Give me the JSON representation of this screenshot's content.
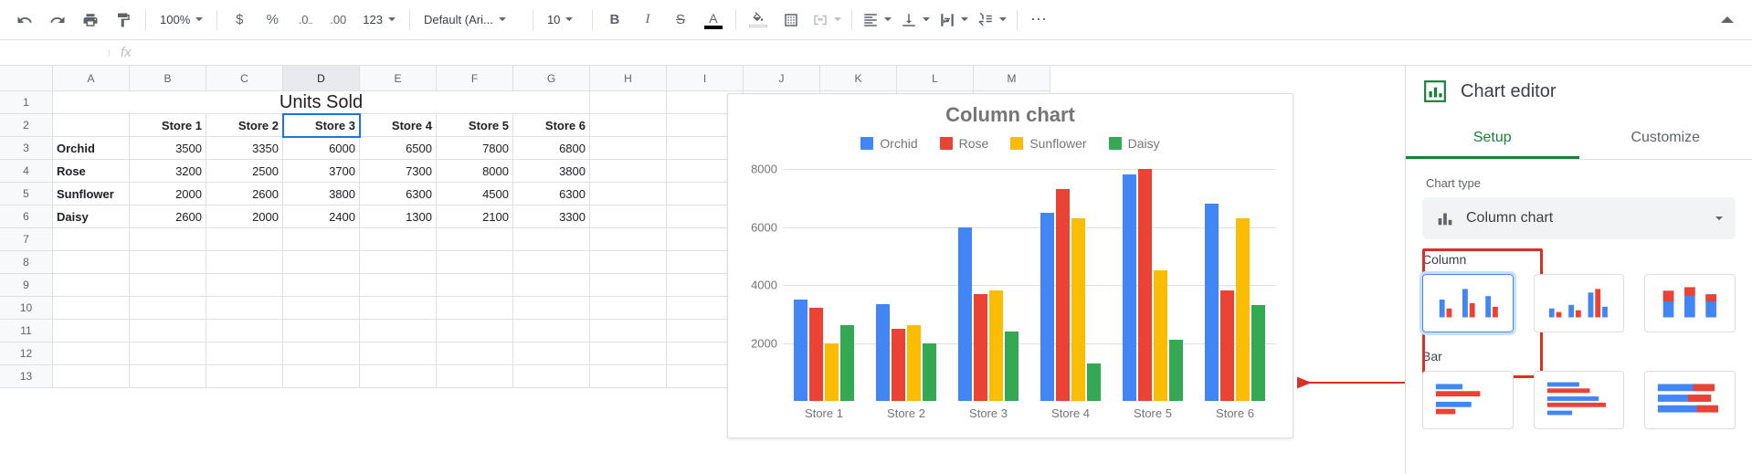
{
  "toolbar": {
    "zoom": "100%",
    "font": "Default (Ari...",
    "font_size": "10",
    "num_format": "123"
  },
  "formula": {
    "name_box": "",
    "fx": "fx"
  },
  "grid": {
    "columns": [
      "A",
      "B",
      "C",
      "D",
      "E",
      "F",
      "G",
      "H",
      "I",
      "J",
      "K",
      "L",
      "M"
    ],
    "selected_col": "D",
    "rows": 13,
    "title": "Units Sold",
    "headers": [
      "",
      "Store 1",
      "Store 2",
      "Store 3",
      "Store 4",
      "Store 5",
      "Store 6"
    ],
    "data_rows": [
      {
        "label": "Orchid",
        "vals": [
          "3500",
          "3350",
          "6000",
          "6500",
          "7800",
          "6800"
        ]
      },
      {
        "label": "Rose",
        "vals": [
          "3200",
          "2500",
          "3700",
          "7300",
          "8000",
          "3800"
        ]
      },
      {
        "label": "Sunflower",
        "vals": [
          "2000",
          "2600",
          "3800",
          "6300",
          "4500",
          "6300"
        ]
      },
      {
        "label": "Daisy",
        "vals": [
          "2600",
          "2000",
          "2400",
          "1300",
          "2100",
          "3300"
        ]
      }
    ]
  },
  "chart_data": {
    "type": "bar",
    "title": "Column chart",
    "categories": [
      "Store 1",
      "Store 2",
      "Store 3",
      "Store 4",
      "Store 5",
      "Store 6"
    ],
    "series": [
      {
        "name": "Orchid",
        "color": "#4285f4",
        "values": [
          3500,
          3350,
          6000,
          6500,
          7800,
          6800
        ]
      },
      {
        "name": "Rose",
        "color": "#ea4335",
        "values": [
          3200,
          2500,
          3700,
          7300,
          8000,
          3800
        ]
      },
      {
        "name": "Sunflower",
        "color": "#fbbc04",
        "values": [
          2000,
          2600,
          3800,
          6300,
          4500,
          6300
        ]
      },
      {
        "name": "Daisy",
        "color": "#34a853",
        "values": [
          2600,
          2000,
          2400,
          1300,
          2100,
          3300
        ]
      }
    ],
    "ylim": [
      0,
      8000
    ],
    "yticks": [
      2000,
      4000,
      6000,
      8000
    ],
    "xlabel": "",
    "ylabel": ""
  },
  "panel": {
    "title": "Chart editor",
    "tabs": {
      "setup": "Setup",
      "customize": "Customize"
    },
    "chart_type_label": "Chart type",
    "chart_type_value": "Column chart",
    "cat_column": "Column",
    "cat_bar": "Bar"
  }
}
